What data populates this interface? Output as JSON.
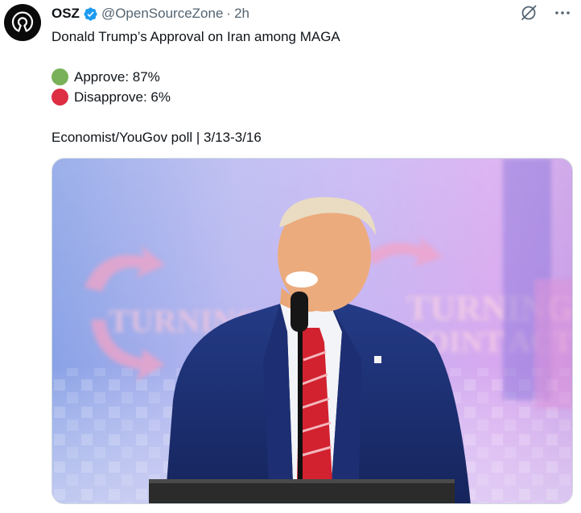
{
  "post": {
    "author": {
      "name": "OSZ",
      "handle": "@OpenSourceZone",
      "separator": "·",
      "timestamp": "2h",
      "verified": true,
      "verified_color": "#1d9bf0"
    },
    "text": {
      "title": "Donald Trump’s Approval on Iran among MAGA",
      "approve": {
        "label": "Approve: 87%",
        "color": "#78b159"
      },
      "disapprove": {
        "label": "Disapprove: 6%",
        "color": "#dd2e44"
      },
      "source": "Economist/YouGov poll | 3/13-3/16"
    },
    "actions": [
      {
        "icon": "grok-icon"
      },
      {
        "icon": "more-options-icon"
      }
    ],
    "media": {
      "type": "photo",
      "background_words": [
        "TURNING",
        "POINT ACTION"
      ]
    }
  }
}
